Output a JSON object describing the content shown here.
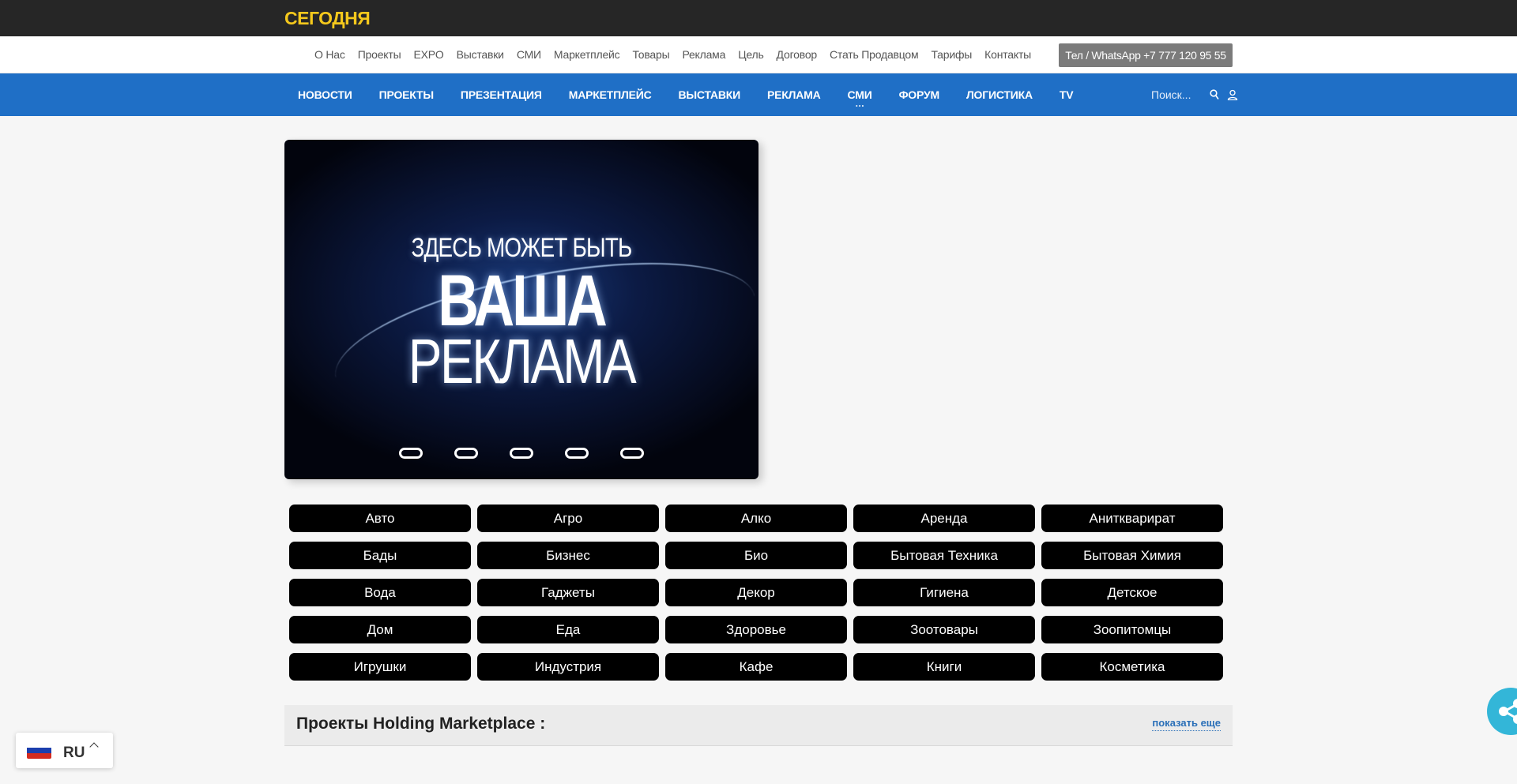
{
  "site": {
    "logo": "СЕГОДНЯ"
  },
  "subnav": {
    "links": [
      "О Нас",
      "Проекты",
      "EXPO",
      "Выставки",
      "СМИ",
      "Маркетплейс",
      "Товары",
      "Реклама",
      "Цель",
      "Договор",
      "Стать Продавцом",
      "Тарифы",
      "Контакты"
    ],
    "phone_button": "Тел / WhatsApp +7 777 120 95 55"
  },
  "mainnav": {
    "links": [
      "НОВОСТИ",
      "ПРОЕКТЫ",
      "ПРЕЗЕНТАЦИЯ",
      "МАРКЕТПЛЕЙС",
      "ВЫСТАВКИ",
      "РЕКЛАМА",
      "СМИ",
      "ФОРУМ",
      "ЛОГИСТИКА",
      "TV"
    ],
    "search_placeholder": "Поиск..."
  },
  "banner": {
    "line1": "ЗДЕСЬ МОЖЕТ БЫТЬ",
    "line2": "ВАША",
    "line3": "РЕКЛАМА",
    "slide_count": 5
  },
  "categories": [
    "Авто",
    "Агро",
    "Алко",
    "Аренда",
    "Аниткварират",
    "Бады",
    "Бизнес",
    "Био",
    "Бытовая Техника",
    "Бытовая Химия",
    "Вода",
    "Гаджеты",
    "Декор",
    "Гигиена",
    "Детское",
    "Дом",
    "Еда",
    "Здоровье",
    "Зоотовары",
    "Зоопитомцы",
    "Игрушки",
    "Индустрия",
    "Кафе",
    "Книги",
    "Косметика"
  ],
  "projects": {
    "title": "Проекты Holding Marketplace :",
    "show_more": "показать еще"
  },
  "language": {
    "code": "RU"
  },
  "colors": {
    "topbar": "#262626",
    "logo": "#f4c81c",
    "mainnav": "#1f6fc6",
    "share": "#33b6d8"
  }
}
